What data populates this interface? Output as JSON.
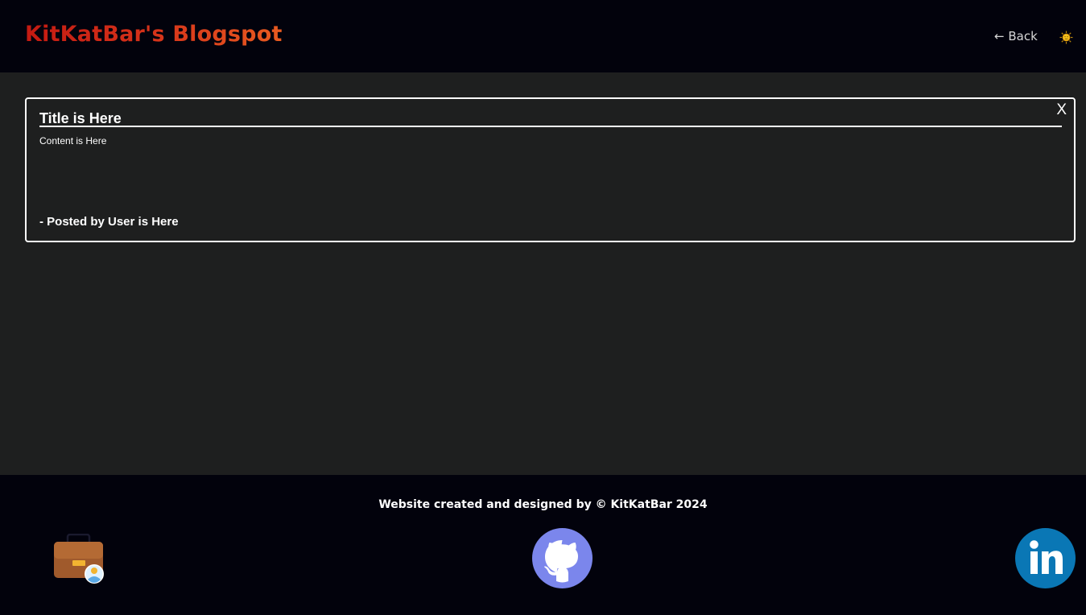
{
  "header": {
    "site_title": "KitKatBar's Blogspot",
    "back_label": "← Back",
    "theme_toggle_icon": "sun-icon"
  },
  "post": {
    "title": "Title is Here",
    "content": "Content is Here",
    "author_line": "- Posted by User is Here",
    "close_label": "X"
  },
  "footer": {
    "credit": "Website created and designed by © KitKatBar 2024",
    "links": [
      {
        "icon": "portfolio-briefcase-icon"
      },
      {
        "icon": "github-icon"
      },
      {
        "icon": "linkedin-icon"
      }
    ]
  },
  "colors": {
    "header_bg": "#02020c",
    "page_bg": "#1e1f1f",
    "title_gradient_start": "#c41a12",
    "title_gradient_end": "#e85b20",
    "github_circle": "#7b86ec",
    "linkedin_circle": "#0a77b5"
  }
}
